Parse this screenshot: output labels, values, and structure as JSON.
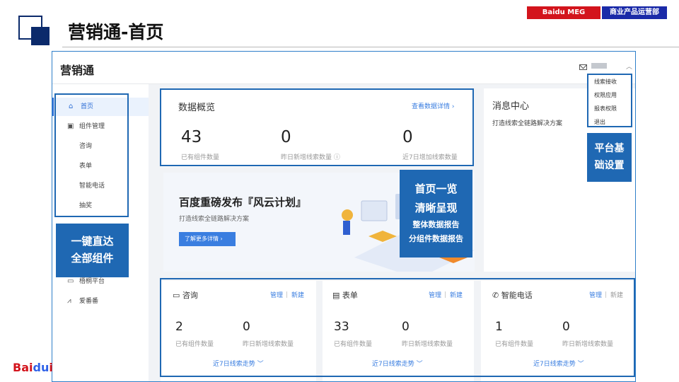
{
  "slide": {
    "title": "营销通-首页",
    "tag_left": "Baidu MEG",
    "tag_right": "商业产品运营部",
    "footer_logo_a": "Bai",
    "footer_logo_b": "du",
    "footer_logo_c": "i"
  },
  "app": {
    "name": "营销通",
    "user_menu": [
      "线索接收",
      "权限应用",
      "报表权限",
      "退出"
    ]
  },
  "sidebar": {
    "items": [
      {
        "label": "首页",
        "icon": "home-icon",
        "active": true
      },
      {
        "label": "组件管理",
        "icon": "component-icon"
      },
      {
        "label": "咨询"
      },
      {
        "label": "表单"
      },
      {
        "label": "智能电话"
      },
      {
        "label": "抽奖"
      },
      {
        "label": "梧桐平台",
        "icon": "platform-icon"
      },
      {
        "label": "爱番番",
        "icon": "aifanfan-icon"
      }
    ]
  },
  "overview": {
    "title": "数据概览",
    "detail_link": "查看数据详情",
    "stats": [
      {
        "value": "43",
        "label": "已有组件数量"
      },
      {
        "value": "0",
        "label": "昨日新增线索数量"
      },
      {
        "value": "0",
        "label": "近7日增加线索数量"
      }
    ]
  },
  "messages": {
    "title": "消息中心",
    "item": "打造线索全链路解决方案"
  },
  "banner": {
    "title": "百度重磅发布『风云计划』",
    "subtitle": "打造线索全链路解决方案",
    "button": "了解更多详情"
  },
  "modules": [
    {
      "title": "咨询",
      "icon": "chat-icon",
      "manage": "管理",
      "create": "新建",
      "count": "2",
      "count_label": "已有组件数量",
      "leads": "0",
      "leads_label": "昨日新增线索数量",
      "trend": "近7日线索走势"
    },
    {
      "title": "表单",
      "icon": "form-icon",
      "manage": "管理",
      "create": "新建",
      "count": "33",
      "count_label": "已有组件数量",
      "leads": "0",
      "leads_label": "昨日新增线索数量",
      "trend": "近7日线索走势"
    },
    {
      "title": "智能电话",
      "icon": "phone-icon",
      "manage": "管理",
      "create": "新建",
      "count": "1",
      "count_label": "已有组件数量",
      "leads": "0",
      "leads_label": "昨日新增线索数量",
      "trend": "近7日线索走势"
    }
  ],
  "callouts": {
    "left_line1": "一键直达",
    "left_line2": "全部组件",
    "center_line1": "首页一览",
    "center_line2": "清晰呈现",
    "center_line3": "整体数据报告",
    "center_line4": "分组件数据报告",
    "right_line1": "平台基",
    "right_line2": "础设置"
  }
}
